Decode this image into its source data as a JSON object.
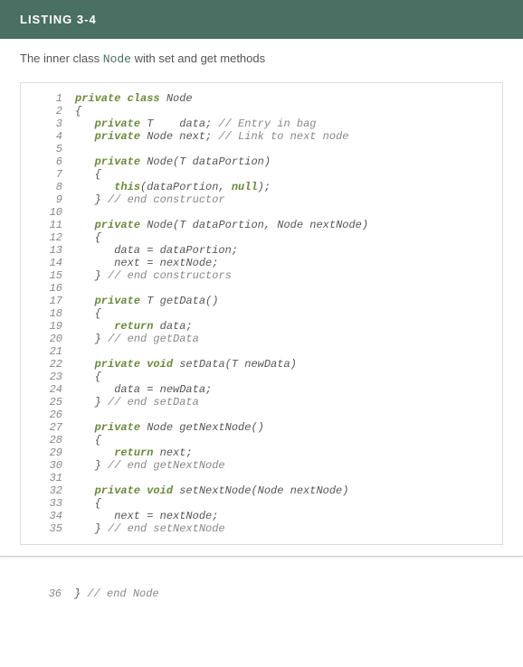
{
  "listing": {
    "label": "LISTING 3-4",
    "caption_prefix": "The inner class ",
    "caption_code": "Node",
    "caption_suffix": " with set and get methods"
  },
  "code": [
    {
      "n": 1,
      "tokens": [
        [
          "kw",
          "private class"
        ],
        [
          "",
          " Node"
        ]
      ]
    },
    {
      "n": 2,
      "tokens": [
        [
          "",
          "{"
        ]
      ]
    },
    {
      "n": 3,
      "tokens": [
        [
          "",
          "   "
        ],
        [
          "kw",
          "private"
        ],
        [
          "",
          " T    data; "
        ],
        [
          "comment",
          "// Entry in bag"
        ]
      ]
    },
    {
      "n": 4,
      "tokens": [
        [
          "",
          "   "
        ],
        [
          "kw",
          "private"
        ],
        [
          "",
          " Node next; "
        ],
        [
          "comment",
          "// Link to next node"
        ]
      ]
    },
    {
      "n": 5,
      "tokens": []
    },
    {
      "n": 6,
      "tokens": [
        [
          "",
          "   "
        ],
        [
          "kw",
          "private"
        ],
        [
          "",
          " Node(T dataPortion)"
        ]
      ]
    },
    {
      "n": 7,
      "tokens": [
        [
          "",
          "   {"
        ]
      ]
    },
    {
      "n": 8,
      "tokens": [
        [
          "",
          "      "
        ],
        [
          "kw",
          "this"
        ],
        [
          "",
          "(dataPortion, "
        ],
        [
          "lit",
          "null"
        ],
        [
          "",
          ");"
        ]
      ]
    },
    {
      "n": 9,
      "tokens": [
        [
          "",
          "   } "
        ],
        [
          "comment",
          "// end constructor"
        ]
      ]
    },
    {
      "n": 10,
      "tokens": []
    },
    {
      "n": 11,
      "tokens": [
        [
          "",
          "   "
        ],
        [
          "kw",
          "private"
        ],
        [
          "",
          " Node(T dataPortion, Node nextNode)"
        ]
      ]
    },
    {
      "n": 12,
      "tokens": [
        [
          "",
          "   {"
        ]
      ]
    },
    {
      "n": 13,
      "tokens": [
        [
          "",
          "      data = dataPortion;"
        ]
      ]
    },
    {
      "n": 14,
      "tokens": [
        [
          "",
          "      next = nextNode;"
        ]
      ]
    },
    {
      "n": 15,
      "tokens": [
        [
          "",
          "   } "
        ],
        [
          "comment",
          "// end constructors"
        ]
      ]
    },
    {
      "n": 16,
      "tokens": []
    },
    {
      "n": 17,
      "tokens": [
        [
          "",
          "   "
        ],
        [
          "kw",
          "private"
        ],
        [
          "",
          " T getData()"
        ]
      ]
    },
    {
      "n": 18,
      "tokens": [
        [
          "",
          "   {"
        ]
      ]
    },
    {
      "n": 19,
      "tokens": [
        [
          "",
          "      "
        ],
        [
          "kw",
          "return"
        ],
        [
          "",
          " data;"
        ]
      ]
    },
    {
      "n": 20,
      "tokens": [
        [
          "",
          "   } "
        ],
        [
          "comment",
          "// end getData"
        ]
      ]
    },
    {
      "n": 21,
      "tokens": []
    },
    {
      "n": 22,
      "tokens": [
        [
          "",
          "   "
        ],
        [
          "kw",
          "private void"
        ],
        [
          "",
          " setData(T newData)"
        ]
      ]
    },
    {
      "n": 23,
      "tokens": [
        [
          "",
          "   {"
        ]
      ]
    },
    {
      "n": 24,
      "tokens": [
        [
          "",
          "      data = newData;"
        ]
      ]
    },
    {
      "n": 25,
      "tokens": [
        [
          "",
          "   } "
        ],
        [
          "comment",
          "// end setData"
        ]
      ]
    },
    {
      "n": 26,
      "tokens": []
    },
    {
      "n": 27,
      "tokens": [
        [
          "",
          "   "
        ],
        [
          "kw",
          "private"
        ],
        [
          "",
          " Node getNextNode()"
        ]
      ]
    },
    {
      "n": 28,
      "tokens": [
        [
          "",
          "   {"
        ]
      ]
    },
    {
      "n": 29,
      "tokens": [
        [
          "",
          "      "
        ],
        [
          "kw",
          "return"
        ],
        [
          "",
          " next;"
        ]
      ]
    },
    {
      "n": 30,
      "tokens": [
        [
          "",
          "   } "
        ],
        [
          "comment",
          "// end getNextNode"
        ]
      ]
    },
    {
      "n": 31,
      "tokens": []
    },
    {
      "n": 32,
      "tokens": [
        [
          "",
          "   "
        ],
        [
          "kw",
          "private void"
        ],
        [
          "",
          " setNextNode(Node nextNode)"
        ]
      ]
    },
    {
      "n": 33,
      "tokens": [
        [
          "",
          "   {"
        ]
      ]
    },
    {
      "n": 34,
      "tokens": [
        [
          "",
          "      next = nextNode;"
        ]
      ]
    },
    {
      "n": 35,
      "tokens": [
        [
          "",
          "   } "
        ],
        [
          "comment",
          "// end setNextNode"
        ]
      ]
    }
  ],
  "after_code": [
    {
      "n": 36,
      "tokens": [
        [
          "",
          "} "
        ],
        [
          "comment",
          "// end Node"
        ]
      ]
    }
  ]
}
